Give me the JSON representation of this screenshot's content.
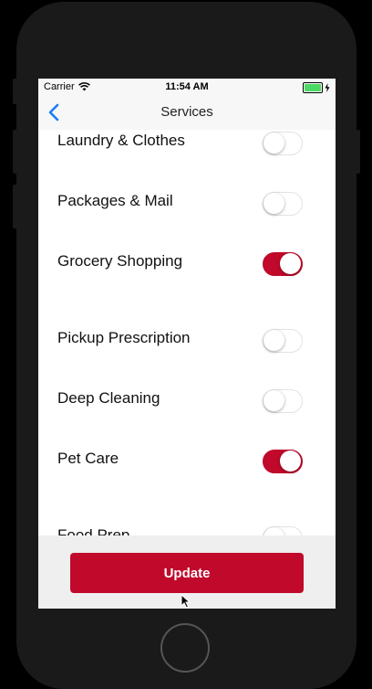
{
  "status_bar": {
    "carrier": "Carrier",
    "time": "11:54 AM"
  },
  "nav": {
    "title": "Services"
  },
  "services": [
    {
      "label": "Laundry & Clothes",
      "enabled": false
    },
    {
      "label": "Packages & Mail",
      "enabled": false
    },
    {
      "label": "Grocery Shopping",
      "enabled": true
    },
    {
      "label": "Pickup Prescription",
      "enabled": false
    },
    {
      "label": "Deep Cleaning",
      "enabled": false
    },
    {
      "label": "Pet Care",
      "enabled": true
    },
    {
      "label": "Food Prep",
      "enabled": false
    }
  ],
  "footer": {
    "update_label": "Update"
  },
  "colors": {
    "accent": "#c0092b",
    "back_arrow": "#1e7cf5"
  }
}
